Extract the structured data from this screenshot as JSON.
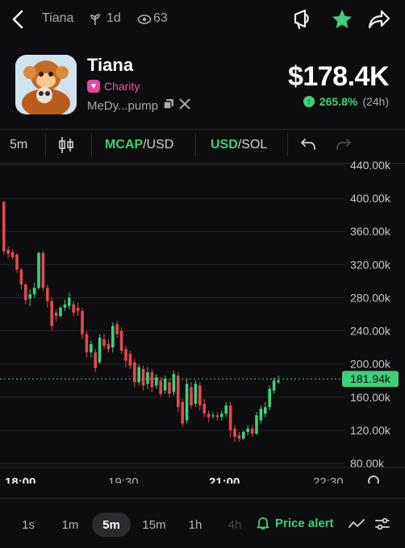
{
  "topbar": {
    "title": "Tiana",
    "age": "1d",
    "watchers": "63"
  },
  "token": {
    "name": "Tiana",
    "badge": "Charity",
    "address": "MeDy...pump",
    "price": "$178.4K",
    "change_pct": "265.8%",
    "change_period": "(24h)"
  },
  "toolbar": {
    "interval": "5m",
    "mcap_label": "MCAP",
    "mcap_quote": "/USD",
    "usd_label": "USD",
    "usd_quote": "/SOL"
  },
  "chart_data": {
    "type": "candlestick",
    "y_ticks": [
      "440.00k",
      "400.00k",
      "360.00k",
      "320.00k",
      "280.00k",
      "240.00k",
      "200.00k",
      "160.00k",
      "120.00k",
      "80.00k"
    ],
    "x_ticks": [
      "18:00",
      "19:30",
      "21:00",
      "22:30"
    ],
    "ylim": [
      80,
      440
    ],
    "current_value": 181.94,
    "current_label": "181.94k",
    "colors": {
      "up": "#3ed07a",
      "down": "#e5484d",
      "grid": "#232327",
      "label_bg": "#3ed07a"
    },
    "candles": [
      [
        396,
        336,
        392,
        332
      ],
      [
        338,
        333,
        342,
        328
      ],
      [
        335,
        329,
        338,
        326
      ],
      [
        332,
        314,
        334,
        310
      ],
      [
        314,
        296,
        316,
        290
      ],
      [
        296,
        277,
        298,
        272
      ],
      [
        279,
        284,
        290,
        270
      ],
      [
        284,
        292,
        298,
        280
      ],
      [
        292,
        334,
        336,
        290
      ],
      [
        334,
        292,
        337,
        288
      ],
      [
        292,
        276,
        296,
        268
      ],
      [
        276,
        246,
        280,
        240
      ],
      [
        262,
        258,
        266,
        252
      ],
      [
        258,
        268,
        270,
        256
      ],
      [
        268,
        272,
        278,
        264
      ],
      [
        270,
        280,
        286,
        266
      ],
      [
        272,
        262,
        276,
        258
      ],
      [
        268,
        264,
        274,
        258
      ],
      [
        264,
        236,
        268,
        230
      ],
      [
        236,
        214,
        240,
        208
      ],
      [
        214,
        224,
        228,
        208
      ],
      [
        214,
        195,
        218,
        190
      ],
      [
        202,
        232,
        236,
        200
      ],
      [
        230,
        222,
        236,
        218
      ],
      [
        224,
        218,
        230,
        214
      ],
      [
        220,
        246,
        250,
        214
      ],
      [
        248,
        236,
        252,
        232
      ],
      [
        240,
        216,
        244,
        212
      ],
      [
        218,
        204,
        222,
        196
      ],
      [
        212,
        198,
        216,
        194
      ],
      [
        202,
        178,
        206,
        172
      ],
      [
        178,
        196,
        200,
        174
      ],
      [
        194,
        174,
        198,
        168
      ],
      [
        176,
        190,
        196,
        170
      ],
      [
        190,
        172,
        194,
        166
      ],
      [
        174,
        184,
        188,
        170
      ],
      [
        180,
        164,
        184,
        160
      ],
      [
        168,
        182,
        186,
        164
      ],
      [
        178,
        164,
        182,
        160
      ],
      [
        166,
        188,
        192,
        162
      ],
      [
        186,
        148,
        190,
        142
      ],
      [
        154,
        128,
        158,
        124
      ],
      [
        132,
        176,
        182,
        128
      ],
      [
        172,
        150,
        178,
        146
      ],
      [
        152,
        176,
        180,
        148
      ],
      [
        174,
        150,
        178,
        144
      ],
      [
        152,
        140,
        158,
        136
      ],
      [
        140,
        136,
        144,
        130
      ],
      [
        138,
        138,
        142,
        134
      ],
      [
        138,
        136,
        142,
        132
      ],
      [
        136,
        140,
        144,
        132
      ],
      [
        140,
        150,
        154,
        136
      ],
      [
        150,
        120,
        154,
        112
      ],
      [
        122,
        112,
        126,
        106
      ],
      [
        114,
        110,
        118,
        106
      ],
      [
        110,
        118,
        120,
        108
      ],
      [
        118,
        122,
        126,
        114
      ],
      [
        122,
        116,
        126,
        112
      ],
      [
        116,
        138,
        142,
        114
      ],
      [
        132,
        146,
        150,
        128
      ],
      [
        140,
        148,
        154,
        136
      ],
      [
        148,
        170,
        174,
        144
      ],
      [
        168,
        180,
        184,
        164
      ],
      [
        178,
        180,
        186,
        176
      ]
    ]
  },
  "timeframes": [
    "1s",
    "1m",
    "5m",
    "15m",
    "1h",
    "4h"
  ],
  "active_timeframe": "5m",
  "price_alert_label": "Price alert"
}
